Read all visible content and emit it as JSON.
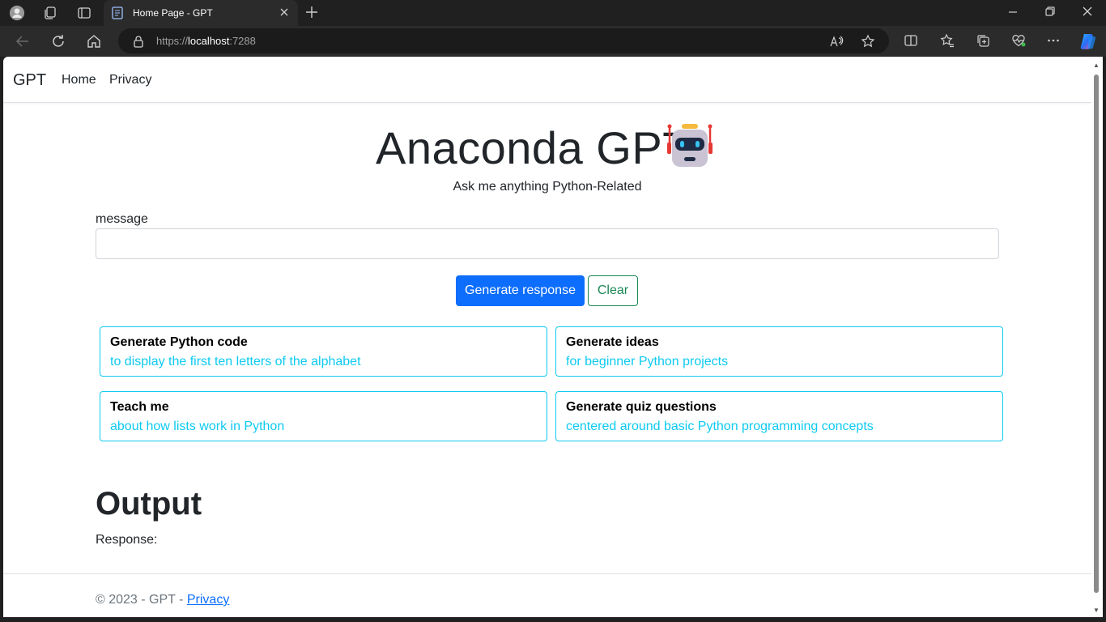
{
  "browser": {
    "tab_title": "Home Page - GPT",
    "url_prefix": "https://",
    "url_host": "localhost",
    "url_port": ":7288",
    "icons": [
      "profile-icon",
      "workspaces-icon",
      "tab-actions-icon",
      "close-icon",
      "new-tab-icon",
      "minimize-icon",
      "maximize-icon",
      "back-icon",
      "refresh-icon",
      "home-icon",
      "lock-icon",
      "read-aloud-icon",
      "favorite-icon",
      "split-screen-icon",
      "favorites-icon",
      "collections-icon",
      "browser-essentials-icon",
      "more-icon",
      "copilot-icon"
    ]
  },
  "navbar": {
    "brand": "GPT",
    "links": [
      "Home",
      "Privacy"
    ]
  },
  "hero": {
    "title": "Anaconda GPT",
    "subtitle": "Ask me anything Python-Related"
  },
  "form": {
    "label": "message",
    "value": "",
    "generate_label": "Generate response",
    "clear_label": "Clear"
  },
  "cards": [
    {
      "title": "Generate Python code",
      "subtitle": "to display the first ten letters of the alphabet"
    },
    {
      "title": "Generate ideas",
      "subtitle": "for beginner Python projects"
    },
    {
      "title": "Teach me",
      "subtitle": "about how lists work in Python"
    },
    {
      "title": "Generate quiz questions",
      "subtitle": "centered around basic Python programming concepts"
    }
  ],
  "output": {
    "heading": "Output",
    "response_label": "Response:"
  },
  "footer": {
    "text": "© 2023 - GPT - ",
    "link": "Privacy"
  },
  "colors": {
    "primary": "#0d6efd",
    "success": "#198754",
    "info": "#0dcaf0"
  }
}
